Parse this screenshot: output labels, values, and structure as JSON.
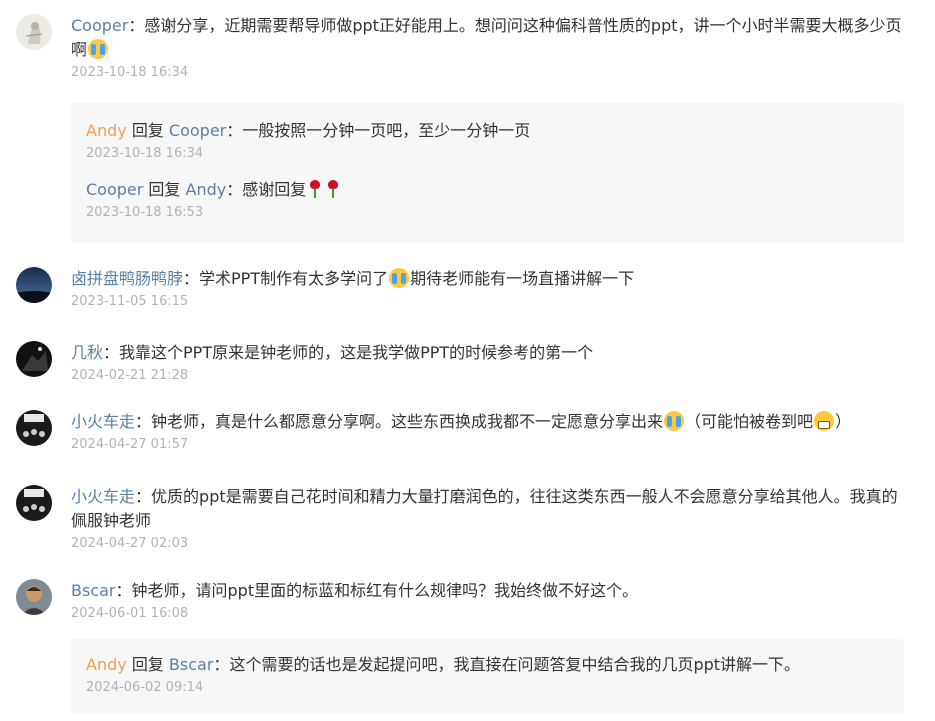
{
  "comments": [
    {
      "author": "Cooper",
      "text": "感谢分享，近期需要帮导师做ppt正好能用上。想问问这种偏科普性质的ppt，讲一个小时半需要大概多少页啊",
      "emoji_end": "crying-emoji",
      "time": "2023-10-18 16:34",
      "replies": [
        {
          "author": "Andy",
          "reply_word": "回复",
          "target": "Cooper",
          "text": "一般按照一分钟一页吧，至少一分钟一页",
          "time": "2023-10-18 16:34"
        },
        {
          "author": "Cooper",
          "reply_word": "回复",
          "target": "Andy",
          "text": "感谢回复",
          "emoji_end": "rose-emoji",
          "time": "2023-10-18 16:53"
        }
      ]
    },
    {
      "author": "卤拼盘鸭肠鸭脖",
      "text_before": "学术PPT制作有太多学问了",
      "text_after": "期待老师能有一场直播讲解一下",
      "time": "2023-11-05 16:15"
    },
    {
      "author": "几秋",
      "text": "我靠这个PPT原来是钟老师的，这是我学做PPT的时候参考的第一个",
      "time": "2024-02-21 21:28"
    },
    {
      "author": "小火车走",
      "text_before": "钟老师，真是什么都愿意分享啊。这些东西换成我都不一定愿意分享出来",
      "text_middle": "（可能怕被卷到吧",
      "text_after": "）",
      "time": "2024-04-27 01:57"
    },
    {
      "author": "小火车走",
      "text": "优质的ppt是需要自己花时间和精力大量打磨润色的，往往这类东西一般人不会愿意分享给其他人。我真的佩服钟老师",
      "time": "2024-04-27 02:03"
    },
    {
      "author": "Bscar",
      "text": "钟老师，请问ppt里面的标蓝和标红有什么规律吗？我始终做不好这个。",
      "time": "2024-06-01 16:08",
      "replies": [
        {
          "author": "Andy",
          "reply_word": "回复",
          "target": "Bscar",
          "text": "这个需要的话也是发起提问吧，我直接在问题答复中结合我的几页ppt讲解一下。",
          "time": "2024-06-02 09:14"
        }
      ]
    }
  ],
  "colon": "：",
  "colors": {
    "author_link": "#5b7fa6",
    "owner_name": "#f0a050",
    "time": "#b3b3b3",
    "reply_bg": "#f7f7f8"
  }
}
